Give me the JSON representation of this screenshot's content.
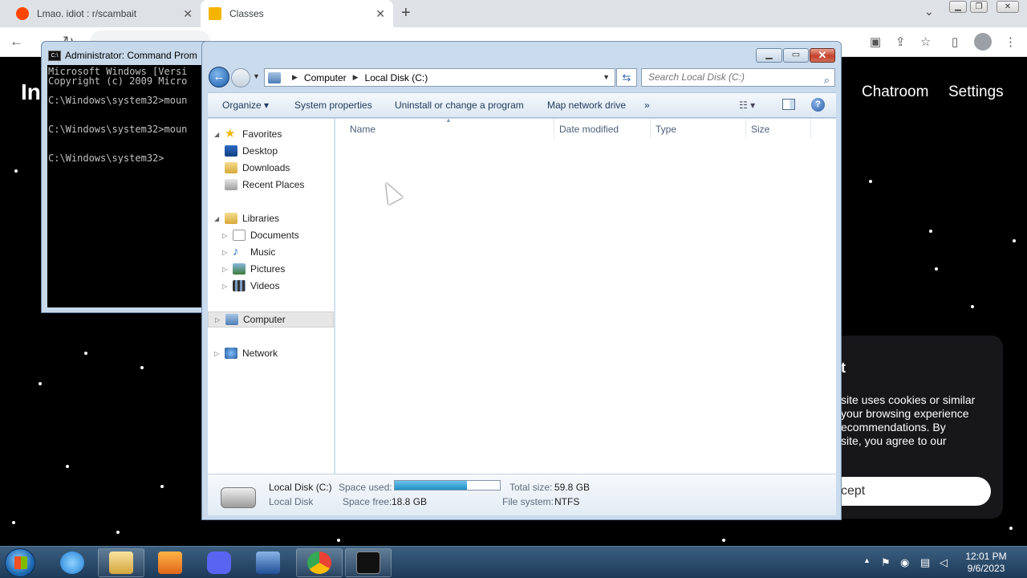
{
  "browser": {
    "tabs": [
      {
        "label": "Lmao. idiot : r/scambait",
        "icon": "reddit-icon",
        "color": "#ff4500"
      },
      {
        "label": "Classes",
        "icon": "classroom-icon",
        "color": "#f4b400"
      }
    ],
    "new_tab": "+",
    "close": "✕"
  },
  "webpage": {
    "logo": "In",
    "nav": [
      "Chatroom",
      "Settings"
    ],
    "cookie": {
      "title": "t",
      "text": "site uses cookies or similar\nyour browsing experience\necommendations. By\nsite, you agree to our",
      "accept": "cept"
    }
  },
  "cmd": {
    "title": "Administrator: Command Prom",
    "lines": "Microsoft Windows [Versi\nCopyright (c) 2009 Micro\n\nC:\\Windows\\system32>moun\n\n\nC:\\Windows\\system32>moun\n\n\nC:\\Windows\\system32>"
  },
  "explorer": {
    "breadcrumb": [
      "Computer",
      "Local Disk (C:)"
    ],
    "search_placeholder": "Search Local Disk (C:)",
    "toolbar": {
      "organize": "Organize",
      "system_properties": "System properties",
      "uninstall": "Uninstall or change a program",
      "map_drive": "Map network drive",
      "more": "»"
    },
    "sidebar": {
      "favorites": "Favorites",
      "desktop": "Desktop",
      "downloads": "Downloads",
      "recent": "Recent Places",
      "libraries": "Libraries",
      "documents": "Documents",
      "music": "Music",
      "pictures": "Pictures",
      "videos": "Videos",
      "computer": "Computer",
      "network": "Network"
    },
    "columns": {
      "name": "Name",
      "date": "Date modified",
      "type": "Type",
      "size": "Size"
    },
    "details": {
      "drive_name": "Local Disk (C:)",
      "drive_type": "Local Disk",
      "space_used_label": "Space used:",
      "space_free_label": "Space free:",
      "space_free": "18.8 GB",
      "total_size_label": "Total size:",
      "total_size": "59.8 GB",
      "file_system_label": "File system:",
      "file_system": "NTFS",
      "used_fraction": 0.686
    }
  },
  "taskbar": {
    "time": "12:01 PM",
    "date": "9/6/2023"
  }
}
